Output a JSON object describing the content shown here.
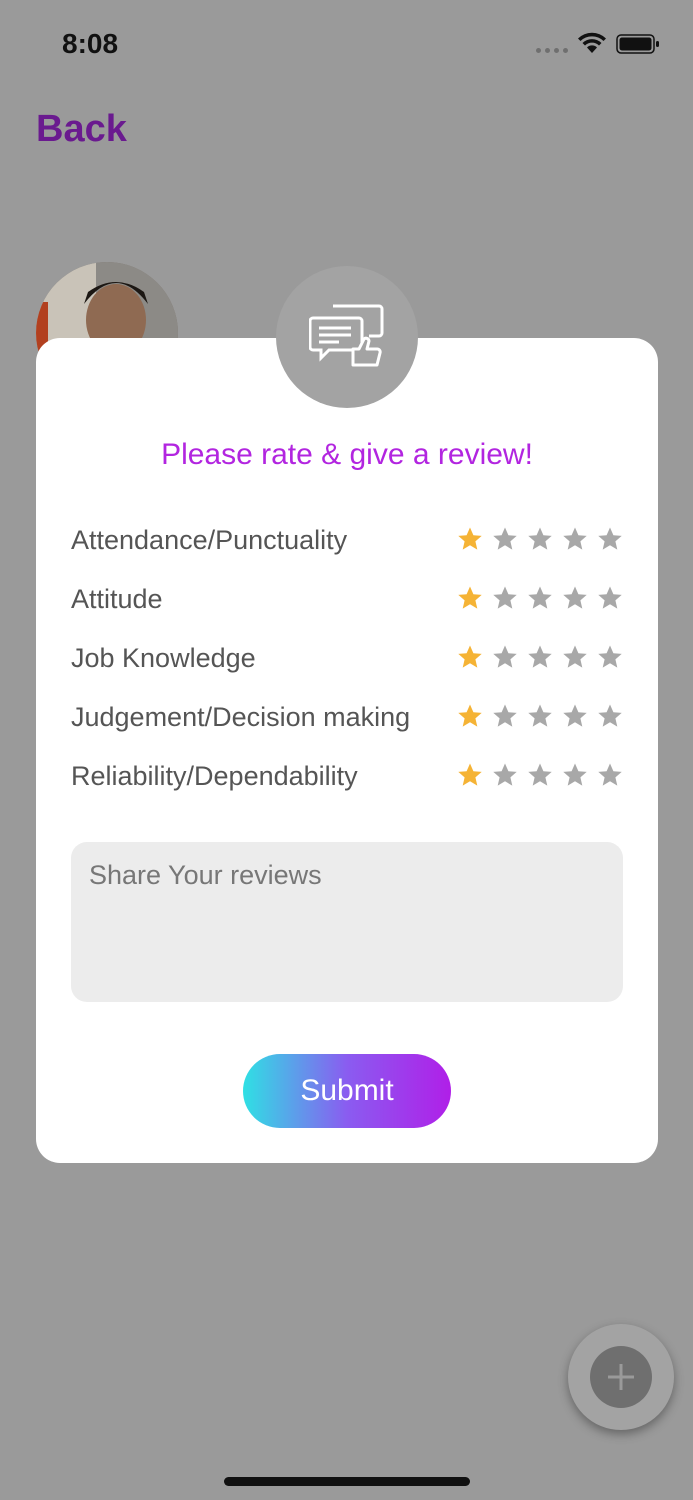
{
  "status_bar": {
    "time": "8:08"
  },
  "nav": {
    "back_label": "Back"
  },
  "modal": {
    "title": "Please rate & give a review!",
    "ratings": [
      {
        "label": "Attendance/Punctuality",
        "stars": 1,
        "max": 5
      },
      {
        "label": "Attitude",
        "stars": 1,
        "max": 5
      },
      {
        "label": "Job Knowledge",
        "stars": 1,
        "max": 5
      },
      {
        "label": "Judgement/Decision making",
        "stars": 1,
        "max": 5
      },
      {
        "label": "Reliability/Dependability",
        "stars": 1,
        "max": 5
      }
    ],
    "review_placeholder": "Share Your reviews",
    "submit_label": "Submit"
  },
  "colors": {
    "accent": "#b225e0",
    "back_link": "#6a1a8f",
    "star_active": "#f5b335",
    "star_inactive": "#a8a8a8",
    "overlay": "#9a9a9a"
  },
  "icons": {
    "badge": "chat-thumbs-up-icon",
    "fab": "plus-icon",
    "star": "star-icon"
  }
}
